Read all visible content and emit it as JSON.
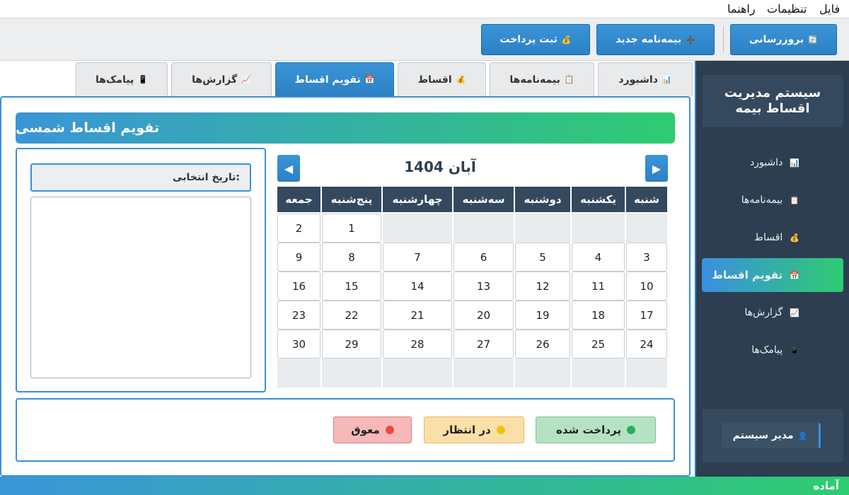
{
  "menu": {
    "file": "فایل",
    "settings": "تنظیمات",
    "help": "راهنما"
  },
  "toolbar": {
    "refresh": {
      "icon": "🔄",
      "label": "بروزرسانی"
    },
    "new_policy": {
      "icon": "➕",
      "label": "بیمه‌نامه جدید"
    },
    "record_payment": {
      "icon": "💰",
      "label": "ثبت پرداخت"
    }
  },
  "sidebar": {
    "title": "سیستم مدیریت اقساط بیمه",
    "items": [
      {
        "icon": "📊",
        "label": "داشبورد"
      },
      {
        "icon": "📋",
        "label": "بیمه‌نامه‌ها"
      },
      {
        "icon": "💰",
        "label": "اقساط"
      },
      {
        "icon": "📅",
        "label": "تقویم اقساط"
      },
      {
        "icon": "📈",
        "label": "گزارش‌ها"
      },
      {
        "icon": "📱",
        "label": "پیامک‌ها"
      }
    ],
    "active_index": 3,
    "user": {
      "icon": "👤",
      "label": "مدیر سیستم"
    }
  },
  "tabs": [
    {
      "icon": "📊",
      "label": "داشبورد"
    },
    {
      "icon": "📋",
      "label": "بیمه‌نامه‌ها"
    },
    {
      "icon": "💰",
      "label": "اقساط"
    },
    {
      "icon": "📅",
      "label": "تقویم اقساط"
    },
    {
      "icon": "📈",
      "label": "گزارش‌ها"
    },
    {
      "icon": "📱",
      "label": "پیامک‌ها"
    }
  ],
  "main": {
    "title": "تقویم اقساط شمسی",
    "selected_date_label": "تاریخ انتخابی:",
    "selected_date_text": ""
  },
  "calendar": {
    "month_title": "آبان 1404",
    "prev_glyph": "◀",
    "next_glyph": "▶",
    "day_names": [
      "شنبه",
      "یکشنبه",
      "دوشنبه",
      "سه‌شنبه",
      "چهارشنبه",
      "پنج‌شنبه",
      "جمعه"
    ],
    "weeks": [
      [
        "",
        "",
        "",
        "",
        "",
        "1",
        "2"
      ],
      [
        "3",
        "4",
        "5",
        "6",
        "7",
        "8",
        "9"
      ],
      [
        "10",
        "11",
        "12",
        "13",
        "14",
        "15",
        "16"
      ],
      [
        "17",
        "18",
        "19",
        "20",
        "21",
        "22",
        "23"
      ],
      [
        "24",
        "25",
        "26",
        "27",
        "28",
        "29",
        "30"
      ],
      [
        "",
        "",
        "",
        "",
        "",
        "",
        ""
      ]
    ]
  },
  "legend": {
    "paid": {
      "label": "پرداخت شده",
      "color": "#27ae60"
    },
    "pending": {
      "label": "در انتظار",
      "color": "#f1c40f"
    },
    "overdue": {
      "label": "معوق",
      "color": "#e74c3c"
    }
  },
  "status": "آماده"
}
